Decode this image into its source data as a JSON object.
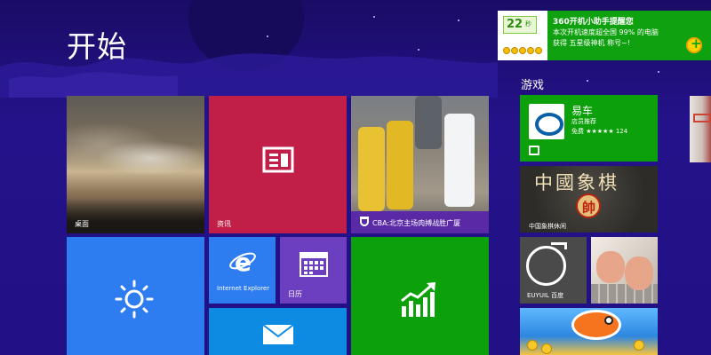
{
  "start": {
    "title": "开始"
  },
  "notification": {
    "counter": "22",
    "counter_unit": "秒",
    "title": "360开机小助手提醒您",
    "line1": "本次开机速度超全国 99% 的电脑",
    "line2": "获得 五星级神机 称号~!"
  },
  "tiles": {
    "desktop": {
      "label": "桌面"
    },
    "news": {
      "label": "资讯"
    },
    "sports": {
      "label": "CBA:北京主场肉搏战胜广厦"
    },
    "weather": {
      "label": ""
    },
    "ie": {
      "label": "Internet Explorer"
    },
    "calendar": {
      "label": "日历"
    },
    "mail": {
      "label": ""
    },
    "finance": {
      "label": ""
    }
  },
  "group": {
    "title": "游戏"
  },
  "game_tiles": {
    "yiche": {
      "name": "易车",
      "sub": "店员推荐",
      "rating": "免费 ★★★★★ 124"
    },
    "chess": {
      "banner": "中國象棋",
      "piece": "帥",
      "label": "中国象棋休闲"
    },
    "bomb": {
      "label": "EUYUIL 百度"
    },
    "typing": {
      "label": ""
    },
    "fish": {
      "label": ""
    }
  },
  "colors": {
    "background": "#1c0f6e",
    "news": "#c21f48",
    "sports_bar": "#5a2aa6",
    "blue_tile": "#2d7cf0",
    "calendar": "#6b3fbf",
    "mail": "#0d8be3",
    "green_tile": "#0ca10a",
    "toast": "#0fa10f"
  },
  "icons": {
    "news": "newspaper-icon",
    "sports": "trophy-icon",
    "weather": "sun-icon",
    "ie": "internet-explorer-icon",
    "calendar": "calendar-icon",
    "mail": "mail-icon",
    "finance": "stock-chart-icon",
    "store": "store-icon",
    "notification": "360-add-icon"
  }
}
